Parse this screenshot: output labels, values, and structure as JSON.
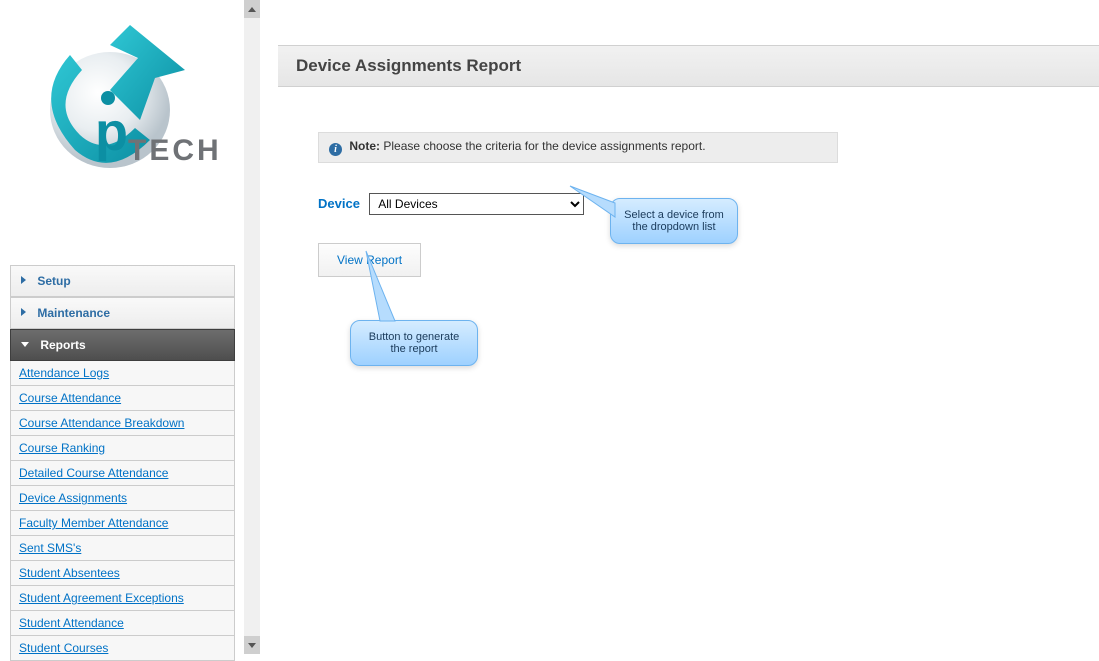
{
  "logo_text": "TECH",
  "nav": {
    "sections": [
      {
        "label": "Setup",
        "expanded": false
      },
      {
        "label": "Maintenance",
        "expanded": false
      },
      {
        "label": "Reports",
        "expanded": true
      }
    ],
    "reports_items": [
      "Attendance Logs",
      "Course Attendance",
      "Course Attendance Breakdown",
      "Course Ranking",
      "Detailed Course Attendance",
      "Device Assignments",
      "Faculty Member Attendance",
      "Sent SMS's",
      "Student Absentees",
      "Student Agreement Exceptions",
      "Student Attendance",
      "Student Courses"
    ]
  },
  "page": {
    "title": "Device Assignments Report",
    "note_label": "Note:",
    "note_text": "Please choose the criteria for the device assignments report.",
    "device_label": "Device",
    "device_selected": "All Devices",
    "view_report_label": "View Report"
  },
  "callouts": {
    "device_tip": "Select a device from the dropdown list",
    "button_tip": "Button to generate the report"
  }
}
